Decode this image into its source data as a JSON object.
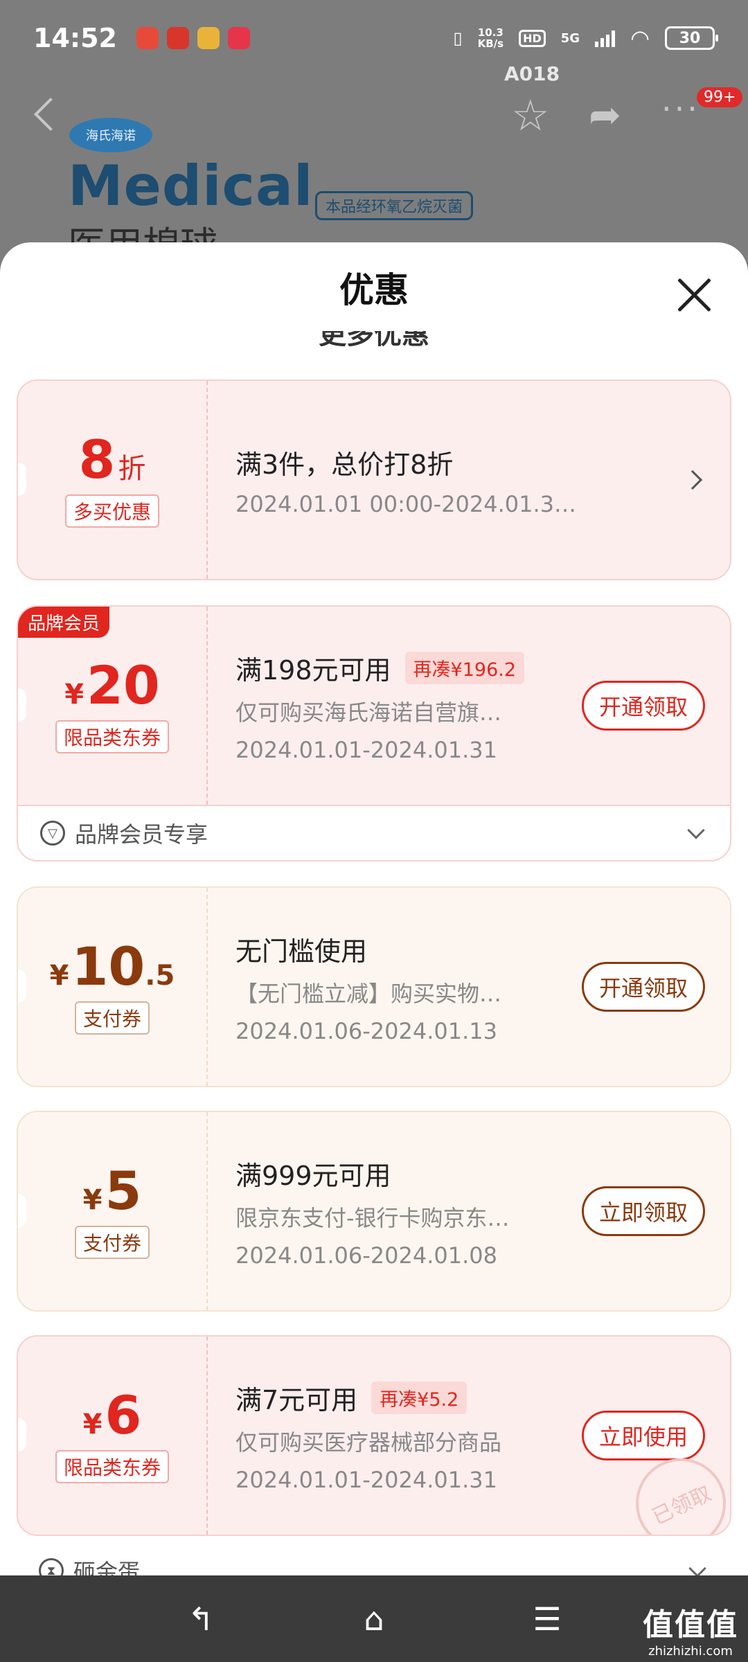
{
  "status_bar": {
    "time": "14:52",
    "net_speed_value": "10.3",
    "net_speed_unit": "KB/s",
    "hd": "HD",
    "network": "5G",
    "battery": "30"
  },
  "product": {
    "code": "A018",
    "brand": "海氏海诺",
    "name_latin": "Medical",
    "name_cn": "医用棉球",
    "sterile_note": "本品经环氧乙烷灭菌",
    "more_badge": "99+"
  },
  "sheet": {
    "title": "优惠",
    "section_peek": "更多优惠"
  },
  "coupons": [
    {
      "amount": "8",
      "suffix": "折",
      "tag": "多买优惠",
      "title": "满3件，总价打8折",
      "date": "2024.01.01 00:00-2024.01.3…"
    },
    {
      "badge": "品牌会员",
      "currency": "¥",
      "amount": "20",
      "tag": "限品类东券",
      "title": "满198元可用",
      "extra": "再凑¥196.2",
      "desc": "仅可购买海氏海诺自营旗…",
      "date": "2024.01.01-2024.01.31",
      "action": "开通领取",
      "footer": "品牌会员专享"
    },
    {
      "currency": "¥",
      "amount": "10",
      "decimal": ".5",
      "tag": "支付券",
      "title": "无门槛使用",
      "desc": "【无门槛立减】购买实物…",
      "date": "2024.01.06-2024.01.13",
      "action": "开通领取"
    },
    {
      "currency": "¥",
      "amount": "5",
      "tag": "支付券",
      "title": "满999元可用",
      "desc": "限京东支付-银行卡购京东…",
      "date": "2024.01.06-2024.01.08",
      "action": "立即领取"
    },
    {
      "currency": "¥",
      "amount": "6",
      "tag": "限品类东券",
      "title": "满7元可用",
      "extra": "再凑¥5.2",
      "desc": "仅可购买医疗器械部分商品",
      "date": "2024.01.01-2024.01.31",
      "action": "立即使用",
      "stamp": "已领取"
    }
  ],
  "peek_row": "砸金蛋",
  "watermark": {
    "main": "值值值",
    "sub": "zhizhizhi.com"
  }
}
